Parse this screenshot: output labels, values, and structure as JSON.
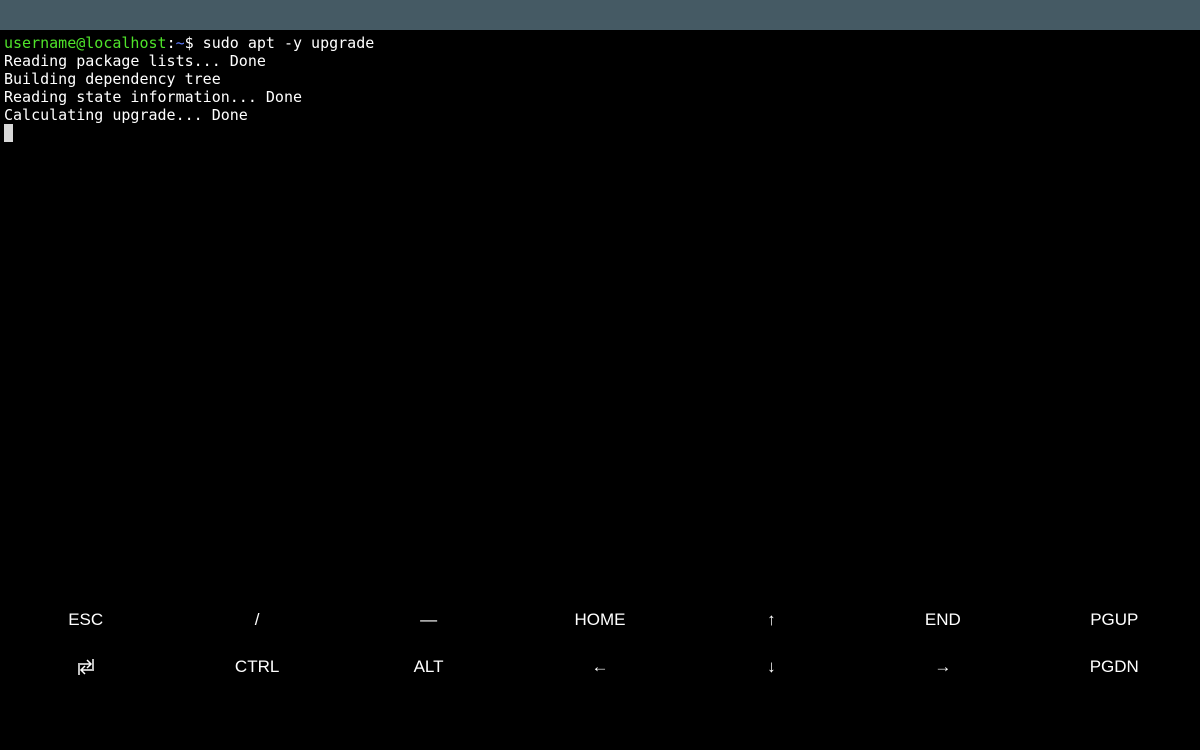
{
  "terminal": {
    "prompt": {
      "user_host": "username@localhost",
      "separator": ":",
      "path": "~",
      "symbol": "$",
      "command": " sudo apt -y upgrade"
    },
    "output_lines": [
      "Reading package lists... Done",
      "Building dependency tree",
      "Reading state information... Done",
      "Calculating upgrade... Done"
    ]
  },
  "extra_keys": {
    "row1": [
      {
        "label": "ESC",
        "name": "esc-key"
      },
      {
        "label": "/",
        "name": "slash-key"
      },
      {
        "label": "—",
        "name": "dash-key"
      },
      {
        "label": "HOME",
        "name": "home-key"
      },
      {
        "label": "↑",
        "name": "up-arrow-key"
      },
      {
        "label": "END",
        "name": "end-key"
      },
      {
        "label": "PGUP",
        "name": "pgup-key"
      }
    ],
    "row2": [
      {
        "label": "",
        "name": "tab-key",
        "icon": "tab-icon"
      },
      {
        "label": "CTRL",
        "name": "ctrl-key"
      },
      {
        "label": "ALT",
        "name": "alt-key"
      },
      {
        "label": "←",
        "name": "left-arrow-key"
      },
      {
        "label": "↓",
        "name": "down-arrow-key"
      },
      {
        "label": "→",
        "name": "right-arrow-key"
      },
      {
        "label": "PGDN",
        "name": "pgdn-key"
      }
    ]
  },
  "colors": {
    "status_bar": "#455a64",
    "background": "#000000",
    "prompt_user": "#4fe32a",
    "prompt_path": "#5f7bff",
    "text": "#ffffff"
  }
}
